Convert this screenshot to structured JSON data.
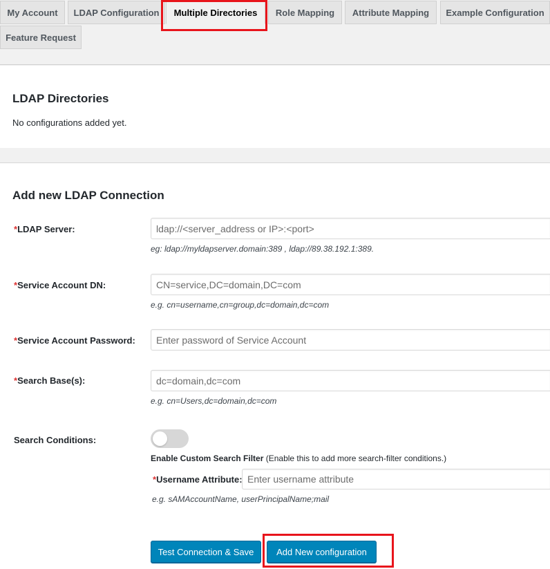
{
  "tabs": [
    {
      "label": "My Account"
    },
    {
      "label": "LDAP Configuration"
    },
    {
      "label": "Multiple Directories"
    },
    {
      "label": "Role Mapping"
    },
    {
      "label": "Attribute Mapping"
    },
    {
      "label": "Example Configuration"
    },
    {
      "label": "Feature Request"
    }
  ],
  "directories": {
    "title": "LDAP Directories",
    "empty_text": "No configurations added yet."
  },
  "add_connection": {
    "title": "Add new LDAP Connection",
    "required_mark": "*",
    "ldap_server": {
      "label": "LDAP Server:",
      "placeholder": "ldap://<server_address or IP>:<port>",
      "hint": "eg: ldap://myldapserver.domain:389 , ldap://89.38.192.1:389."
    },
    "service_dn": {
      "label": "Service Account DN:",
      "placeholder": "CN=service,DC=domain,DC=com",
      "hint": "e.g. cn=username,cn=group,dc=domain,dc=com"
    },
    "service_password": {
      "label": "Service Account Password:",
      "placeholder": "Enter password of Service Account"
    },
    "search_base": {
      "label": "Search Base(s):",
      "placeholder": "dc=domain,dc=com",
      "hint": "e.g. cn=Users,dc=domain,dc=com"
    },
    "search_conditions": {
      "label": "Search Conditions:",
      "toggle_on": false,
      "filter_title": "Enable Custom Search Filter",
      "filter_desc": " (Enable this to add more search-filter conditions.)"
    },
    "username_attribute": {
      "label": "Username Attribute:",
      "placeholder": "Enter username attribute",
      "hint": "e.g. sAMAccountName, userPrincipalName;mail"
    },
    "buttons": {
      "test_save": "Test Connection & Save",
      "add_new": "Add New configuration"
    }
  },
  "colors": {
    "highlight": "#e8141b",
    "button_primary": "#0085ba",
    "required": "#dc3232"
  }
}
